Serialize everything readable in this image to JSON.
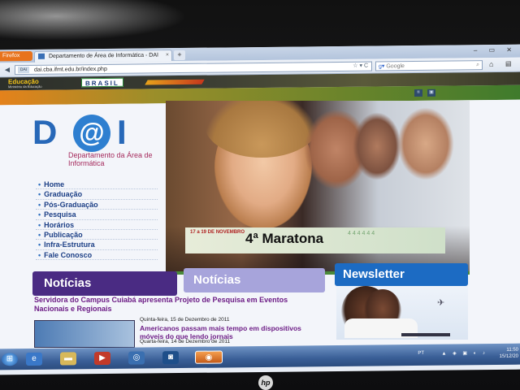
{
  "browser": {
    "app_button": "Firefox",
    "tab_title": "Departamento de Área de Informática - DAI",
    "tab_close": "×",
    "new_tab": "+",
    "window_buttons": "‒ ▭ ✕",
    "url": "dai.cba.ifmt.edu.br/index.php",
    "url_favicon": "DAI",
    "search_placeholder": "Google",
    "home_icon": "⌂",
    "bookmarks_icon": "▤"
  },
  "gov_bar": {
    "education": "Educação",
    "ministry": "Ministério da Educação",
    "brasil": "BRASIL"
  },
  "site": {
    "logo": {
      "d": "D",
      "at": "@",
      "i": "I"
    },
    "department": "Departamento da Área de Informática",
    "menu": [
      {
        "label": "Home"
      },
      {
        "label": "Graduação"
      },
      {
        "label": "Pós-Graduação"
      },
      {
        "label": "Pesquisa"
      },
      {
        "label": "Horários"
      },
      {
        "label": "Publicação"
      },
      {
        "label": "Infra-Estrutura"
      },
      {
        "label": "Fale Conosco"
      }
    ],
    "banner": {
      "date": "17 a 19 DE NOVEMBRO",
      "title": "4ª Maratona"
    },
    "sections": {
      "noticias_primary": "Notícias",
      "noticias_secondary": "Notícias",
      "newsletter": "Newsletter"
    },
    "news": [
      {
        "headline": "Servidora do Campus Cuiabá apresenta Projeto de Pesquisa em Eventos Nacionais e Regionais",
        "date": ""
      },
      {
        "headline": "Americanos passam mais tempo em dispositivos móveis do que lendo jornais",
        "date": "Quinta-feira, 15 de Dezembro de 2011"
      }
    ],
    "news_date_2": "Quarta-feira, 14 de Dezembro de 2011"
  },
  "taskbar": {
    "language": "PT",
    "clock_time": "11:50",
    "clock_date": "15/12/20"
  },
  "device": {
    "brand": "hp"
  },
  "colors": {
    "noticias_purple": "#4a2b83",
    "noticias_light": "#a7a4db",
    "newsletter_blue": "#1c6bc3",
    "logo_blue": "#2768b8",
    "menu_blue": "#1c3f86",
    "headline_purple": "#6d1d86"
  }
}
